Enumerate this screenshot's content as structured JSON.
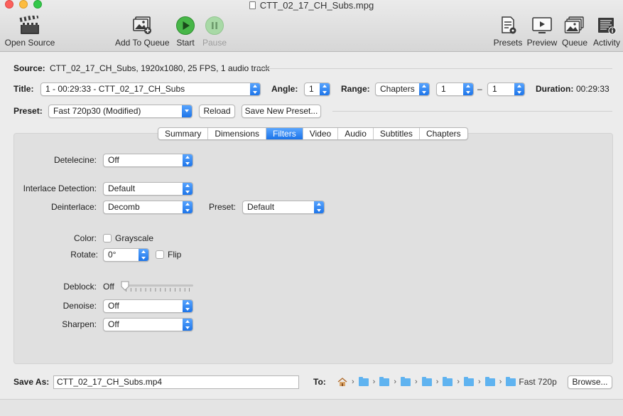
{
  "window": {
    "title": "CTT_02_17_CH_Subs.mpg"
  },
  "toolbar": {
    "open_source": "Open Source",
    "add_to_queue": "Add To Queue",
    "start": "Start",
    "pause": "Pause",
    "presets": "Presets",
    "preview": "Preview",
    "queue": "Queue",
    "activity": "Activity"
  },
  "source": {
    "label": "Source:",
    "value": "CTT_02_17_CH_Subs, 1920x1080, 25 FPS, 1 audio track"
  },
  "title_row": {
    "label": "Title:",
    "value": "1 - 00:29:33 - CTT_02_17_CH_Subs",
    "angle_label": "Angle:",
    "angle_value": "1",
    "range_label": "Range:",
    "range_value": "Chapters",
    "range_start": "1",
    "range_dash": "–",
    "range_end": "1",
    "duration_label": "Duration:",
    "duration_value": "00:29:33"
  },
  "preset_row": {
    "label": "Preset:",
    "value": "Fast 720p30 (Modified)",
    "reload": "Reload",
    "save_new": "Save New Preset..."
  },
  "tabs": [
    {
      "label": "Summary",
      "active": false
    },
    {
      "label": "Dimensions",
      "active": false
    },
    {
      "label": "Filters",
      "active": true
    },
    {
      "label": "Video",
      "active": false
    },
    {
      "label": "Audio",
      "active": false
    },
    {
      "label": "Subtitles",
      "active": false
    },
    {
      "label": "Chapters",
      "active": false
    }
  ],
  "filters": {
    "detelecine_label": "Detelecine:",
    "detelecine_value": "Off",
    "interlace_label": "Interlace Detection:",
    "interlace_value": "Default",
    "deinterlace_label": "Deinterlace:",
    "deinterlace_value": "Decomb",
    "deint_preset_label": "Preset:",
    "deint_preset_value": "Default",
    "color_label": "Color:",
    "grayscale_label": "Grayscale",
    "grayscale_checked": false,
    "rotate_label": "Rotate:",
    "rotate_value": "0°",
    "flip_label": "Flip",
    "flip_checked": false,
    "deblock_label": "Deblock:",
    "deblock_value": "Off",
    "deblock_level": 0,
    "denoise_label": "Denoise:",
    "denoise_value": "Off",
    "sharpen_label": "Sharpen:",
    "sharpen_value": "Off"
  },
  "save": {
    "label": "Save As:",
    "value": "CTT_02_17_CH_Subs.mp4",
    "to_label": "To:",
    "path_last": "Fast 720p",
    "browse": "Browse..."
  },
  "colors": {
    "accent": "#1a72e8",
    "start_green": "#33a935",
    "folder_blue": "#5fb3f0"
  }
}
